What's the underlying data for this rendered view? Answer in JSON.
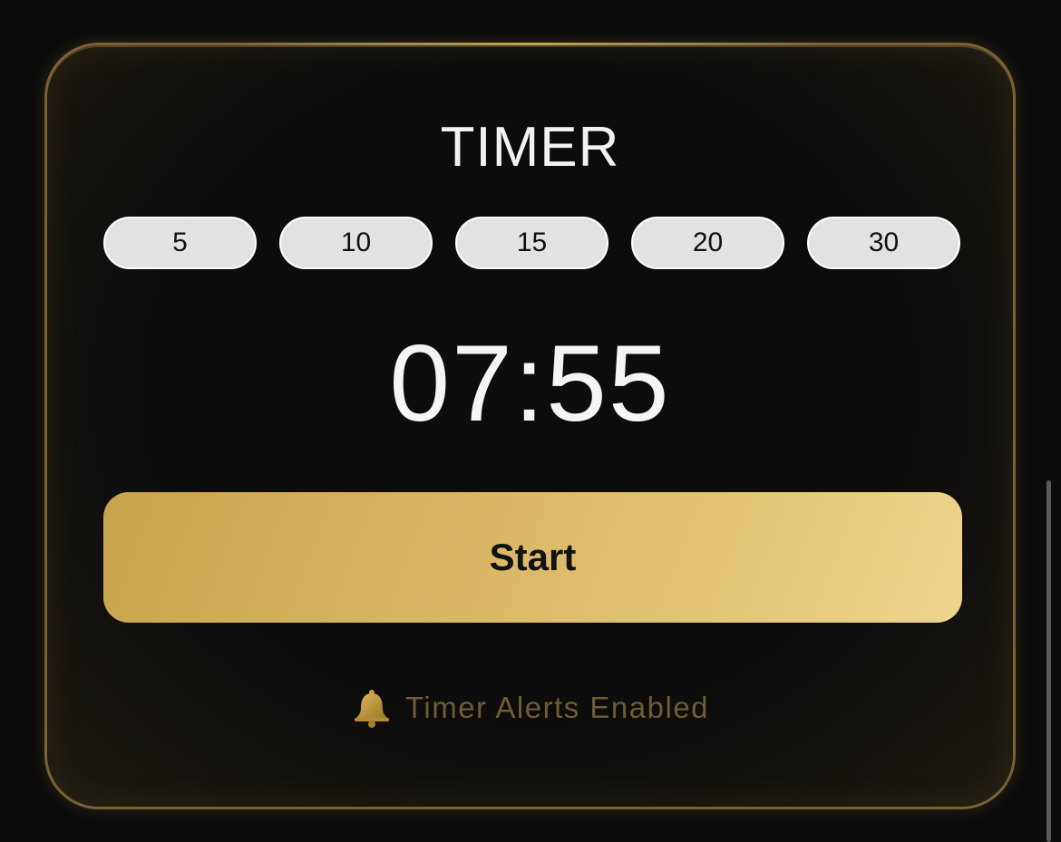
{
  "timer": {
    "title": "TIMER",
    "presets": [
      "5",
      "10",
      "15",
      "20",
      "30"
    ],
    "display_time": "07:55",
    "start_label": "Start",
    "alerts_text": "Timer Alerts Enabled",
    "alerts_icon": "bell-icon"
  },
  "colors": {
    "accent_gold": "#c9a454",
    "start_gradient_start": "#c9a44e",
    "start_gradient_end": "#efd48c",
    "background": "#0b0b0b",
    "alerts_text": "#6f5c35"
  }
}
